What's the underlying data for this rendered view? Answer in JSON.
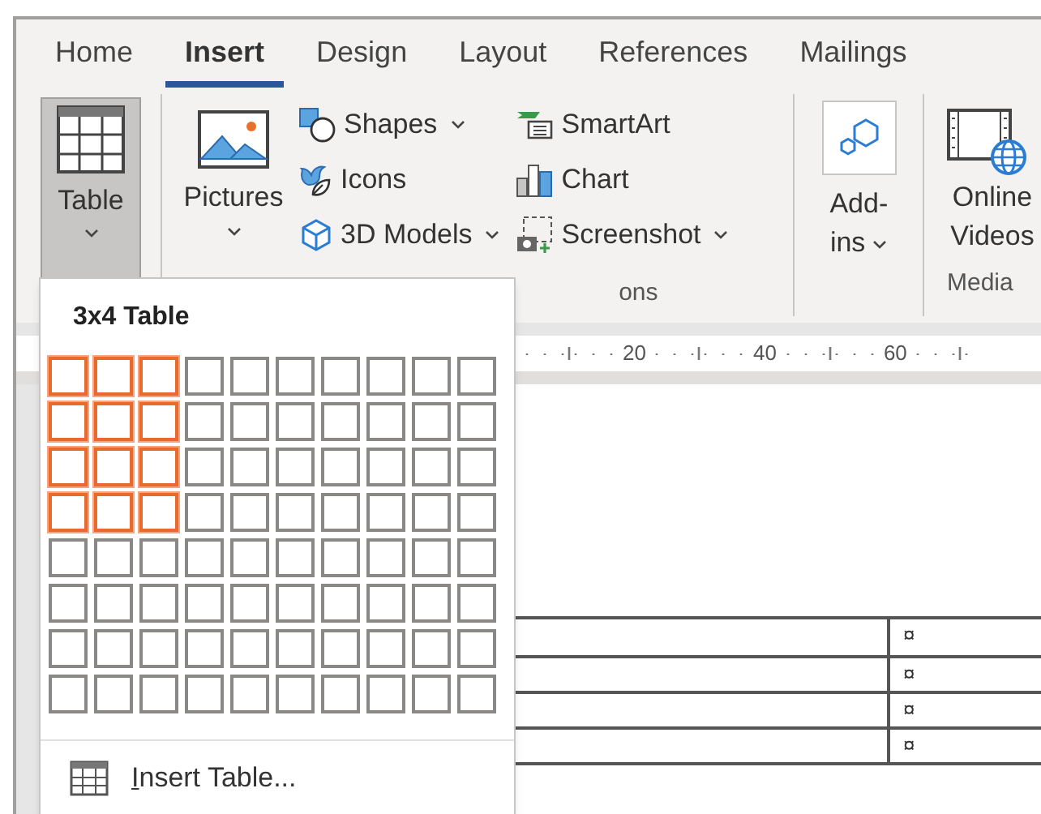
{
  "tabs": [
    {
      "label": "Home",
      "selected": false
    },
    {
      "label": "Insert",
      "selected": true
    },
    {
      "label": "Design",
      "selected": false
    },
    {
      "label": "Layout",
      "selected": false
    },
    {
      "label": "References",
      "selected": false
    },
    {
      "label": "Mailings",
      "selected": false
    }
  ],
  "ribbon": {
    "table_button": {
      "label": "Table",
      "pressed": true
    },
    "illustrations": {
      "pictures": "Pictures",
      "small_buttons": [
        {
          "kind": "shapes",
          "label": "Shapes",
          "dropdown": true
        },
        {
          "kind": "icons",
          "label": "Icons",
          "dropdown": false
        },
        {
          "kind": "models",
          "label": "3D Models",
          "dropdown": true
        },
        {
          "kind": "smartart",
          "label": "SmartArt",
          "dropdown": false
        },
        {
          "kind": "chart",
          "label": "Chart",
          "dropdown": false
        },
        {
          "kind": "screenshot",
          "label": "Screenshot",
          "dropdown": true
        }
      ],
      "group_label": "ons"
    },
    "addins": {
      "label": "Add-ins"
    },
    "media": {
      "label": "Online Videos",
      "group_label": "Media"
    }
  },
  "ruler": {
    "labels": [
      "20",
      "40",
      "60"
    ]
  },
  "document_table": {
    "rows": [
      {
        "cell_2": "¤"
      },
      {
        "cell_2": "¤"
      },
      {
        "cell_2": "¤"
      },
      {
        "cell_2": "¤"
      }
    ]
  },
  "table_popup": {
    "title": "3x4 Table",
    "grid_rows": [
      {
        "cells": [
          {
            "selected": true
          },
          {
            "selected": true
          },
          {
            "selected": true
          },
          {
            "selected": false
          },
          {
            "selected": false
          },
          {
            "selected": false
          },
          {
            "selected": false
          },
          {
            "selected": false
          },
          {
            "selected": false
          },
          {
            "selected": false
          }
        ]
      },
      {
        "cells": [
          {
            "selected": true
          },
          {
            "selected": true
          },
          {
            "selected": true
          },
          {
            "selected": false
          },
          {
            "selected": false
          },
          {
            "selected": false
          },
          {
            "selected": false
          },
          {
            "selected": false
          },
          {
            "selected": false
          },
          {
            "selected": false
          }
        ]
      },
      {
        "cells": [
          {
            "selected": true
          },
          {
            "selected": true
          },
          {
            "selected": true
          },
          {
            "selected": false
          },
          {
            "selected": false
          },
          {
            "selected": false
          },
          {
            "selected": false
          },
          {
            "selected": false
          },
          {
            "selected": false
          },
          {
            "selected": false
          }
        ]
      },
      {
        "cells": [
          {
            "selected": true
          },
          {
            "selected": true
          },
          {
            "selected": true
          },
          {
            "selected": false
          },
          {
            "selected": false
          },
          {
            "selected": false
          },
          {
            "selected": false
          },
          {
            "selected": false
          },
          {
            "selected": false
          },
          {
            "selected": false
          }
        ]
      },
      {
        "cells": [
          {
            "selected": false
          },
          {
            "selected": false
          },
          {
            "selected": false
          },
          {
            "selected": false
          },
          {
            "selected": false
          },
          {
            "selected": false
          },
          {
            "selected": false
          },
          {
            "selected": false
          },
          {
            "selected": false
          },
          {
            "selected": false
          }
        ]
      },
      {
        "cells": [
          {
            "selected": false
          },
          {
            "selected": false
          },
          {
            "selected": false
          },
          {
            "selected": false
          },
          {
            "selected": false
          },
          {
            "selected": false
          },
          {
            "selected": false
          },
          {
            "selected": false
          },
          {
            "selected": false
          },
          {
            "selected": false
          }
        ]
      },
      {
        "cells": [
          {
            "selected": false
          },
          {
            "selected": false
          },
          {
            "selected": false
          },
          {
            "selected": false
          },
          {
            "selected": false
          },
          {
            "selected": false
          },
          {
            "selected": false
          },
          {
            "selected": false
          },
          {
            "selected": false
          },
          {
            "selected": false
          }
        ]
      },
      {
        "cells": [
          {
            "selected": false
          },
          {
            "selected": false
          },
          {
            "selected": false
          },
          {
            "selected": false
          },
          {
            "selected": false
          },
          {
            "selected": false
          },
          {
            "selected": false
          },
          {
            "selected": false
          },
          {
            "selected": false
          },
          {
            "selected": false
          }
        ]
      }
    ],
    "menu_item": {
      "access_key": "I",
      "rest": "nsert Table..."
    }
  }
}
